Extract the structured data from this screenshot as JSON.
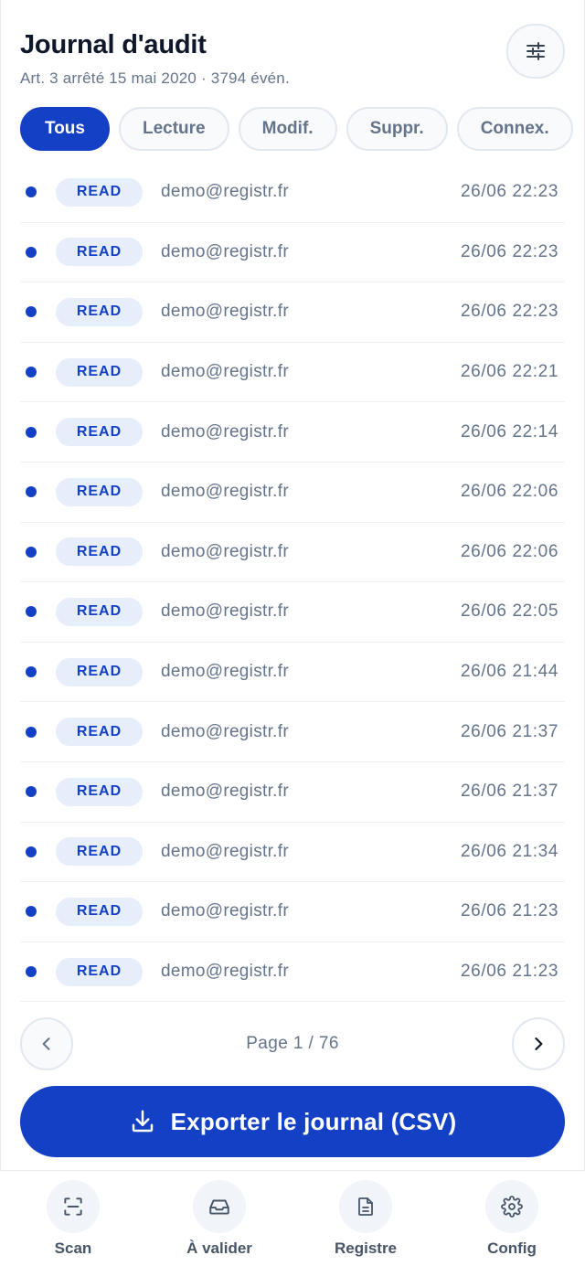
{
  "header": {
    "title": "Journal d'audit",
    "subtitle": "Art. 3 arrêté 15 mai 2020 · 3794 évén.",
    "filter_icon": "sliders-icon"
  },
  "chips": [
    {
      "label": "Tous",
      "active": true
    },
    {
      "label": "Lecture",
      "active": false
    },
    {
      "label": "Modif.",
      "active": false
    },
    {
      "label": "Suppr.",
      "active": false
    },
    {
      "label": "Connex.",
      "active": false
    }
  ],
  "events": [
    {
      "action": "READ",
      "user": "demo@registr.fr",
      "time": "26/06 22:23"
    },
    {
      "action": "READ",
      "user": "demo@registr.fr",
      "time": "26/06 22:23"
    },
    {
      "action": "READ",
      "user": "demo@registr.fr",
      "time": "26/06 22:23"
    },
    {
      "action": "READ",
      "user": "demo@registr.fr",
      "time": "26/06 22:21"
    },
    {
      "action": "READ",
      "user": "demo@registr.fr",
      "time": "26/06 22:14"
    },
    {
      "action": "READ",
      "user": "demo@registr.fr",
      "time": "26/06 22:06"
    },
    {
      "action": "READ",
      "user": "demo@registr.fr",
      "time": "26/06 22:06"
    },
    {
      "action": "READ",
      "user": "demo@registr.fr",
      "time": "26/06 22:05"
    },
    {
      "action": "READ",
      "user": "demo@registr.fr",
      "time": "26/06 21:44"
    },
    {
      "action": "READ",
      "user": "demo@registr.fr",
      "time": "26/06 21:37"
    },
    {
      "action": "READ",
      "user": "demo@registr.fr",
      "time": "26/06 21:37"
    },
    {
      "action": "READ",
      "user": "demo@registr.fr",
      "time": "26/06 21:34"
    },
    {
      "action": "READ",
      "user": "demo@registr.fr",
      "time": "26/06 21:23"
    },
    {
      "action": "READ",
      "user": "demo@registr.fr",
      "time": "26/06 21:23"
    }
  ],
  "pager": {
    "label": "Page 1 / 76",
    "prev_icon": "chevron-left-icon",
    "next_icon": "chevron-right-icon"
  },
  "export": {
    "label": "Exporter le journal (CSV)",
    "icon": "download-icon"
  },
  "tabbar": [
    {
      "label": "Scan",
      "icon": "scan-icon"
    },
    {
      "label": "À valider",
      "icon": "inbox-icon"
    },
    {
      "label": "Registre",
      "icon": "document-icon"
    },
    {
      "label": "Config",
      "icon": "gear-icon"
    }
  ],
  "colors": {
    "accent": "#1340c5",
    "badge_bg": "#e6eefc",
    "muted_text": "#64748b"
  }
}
